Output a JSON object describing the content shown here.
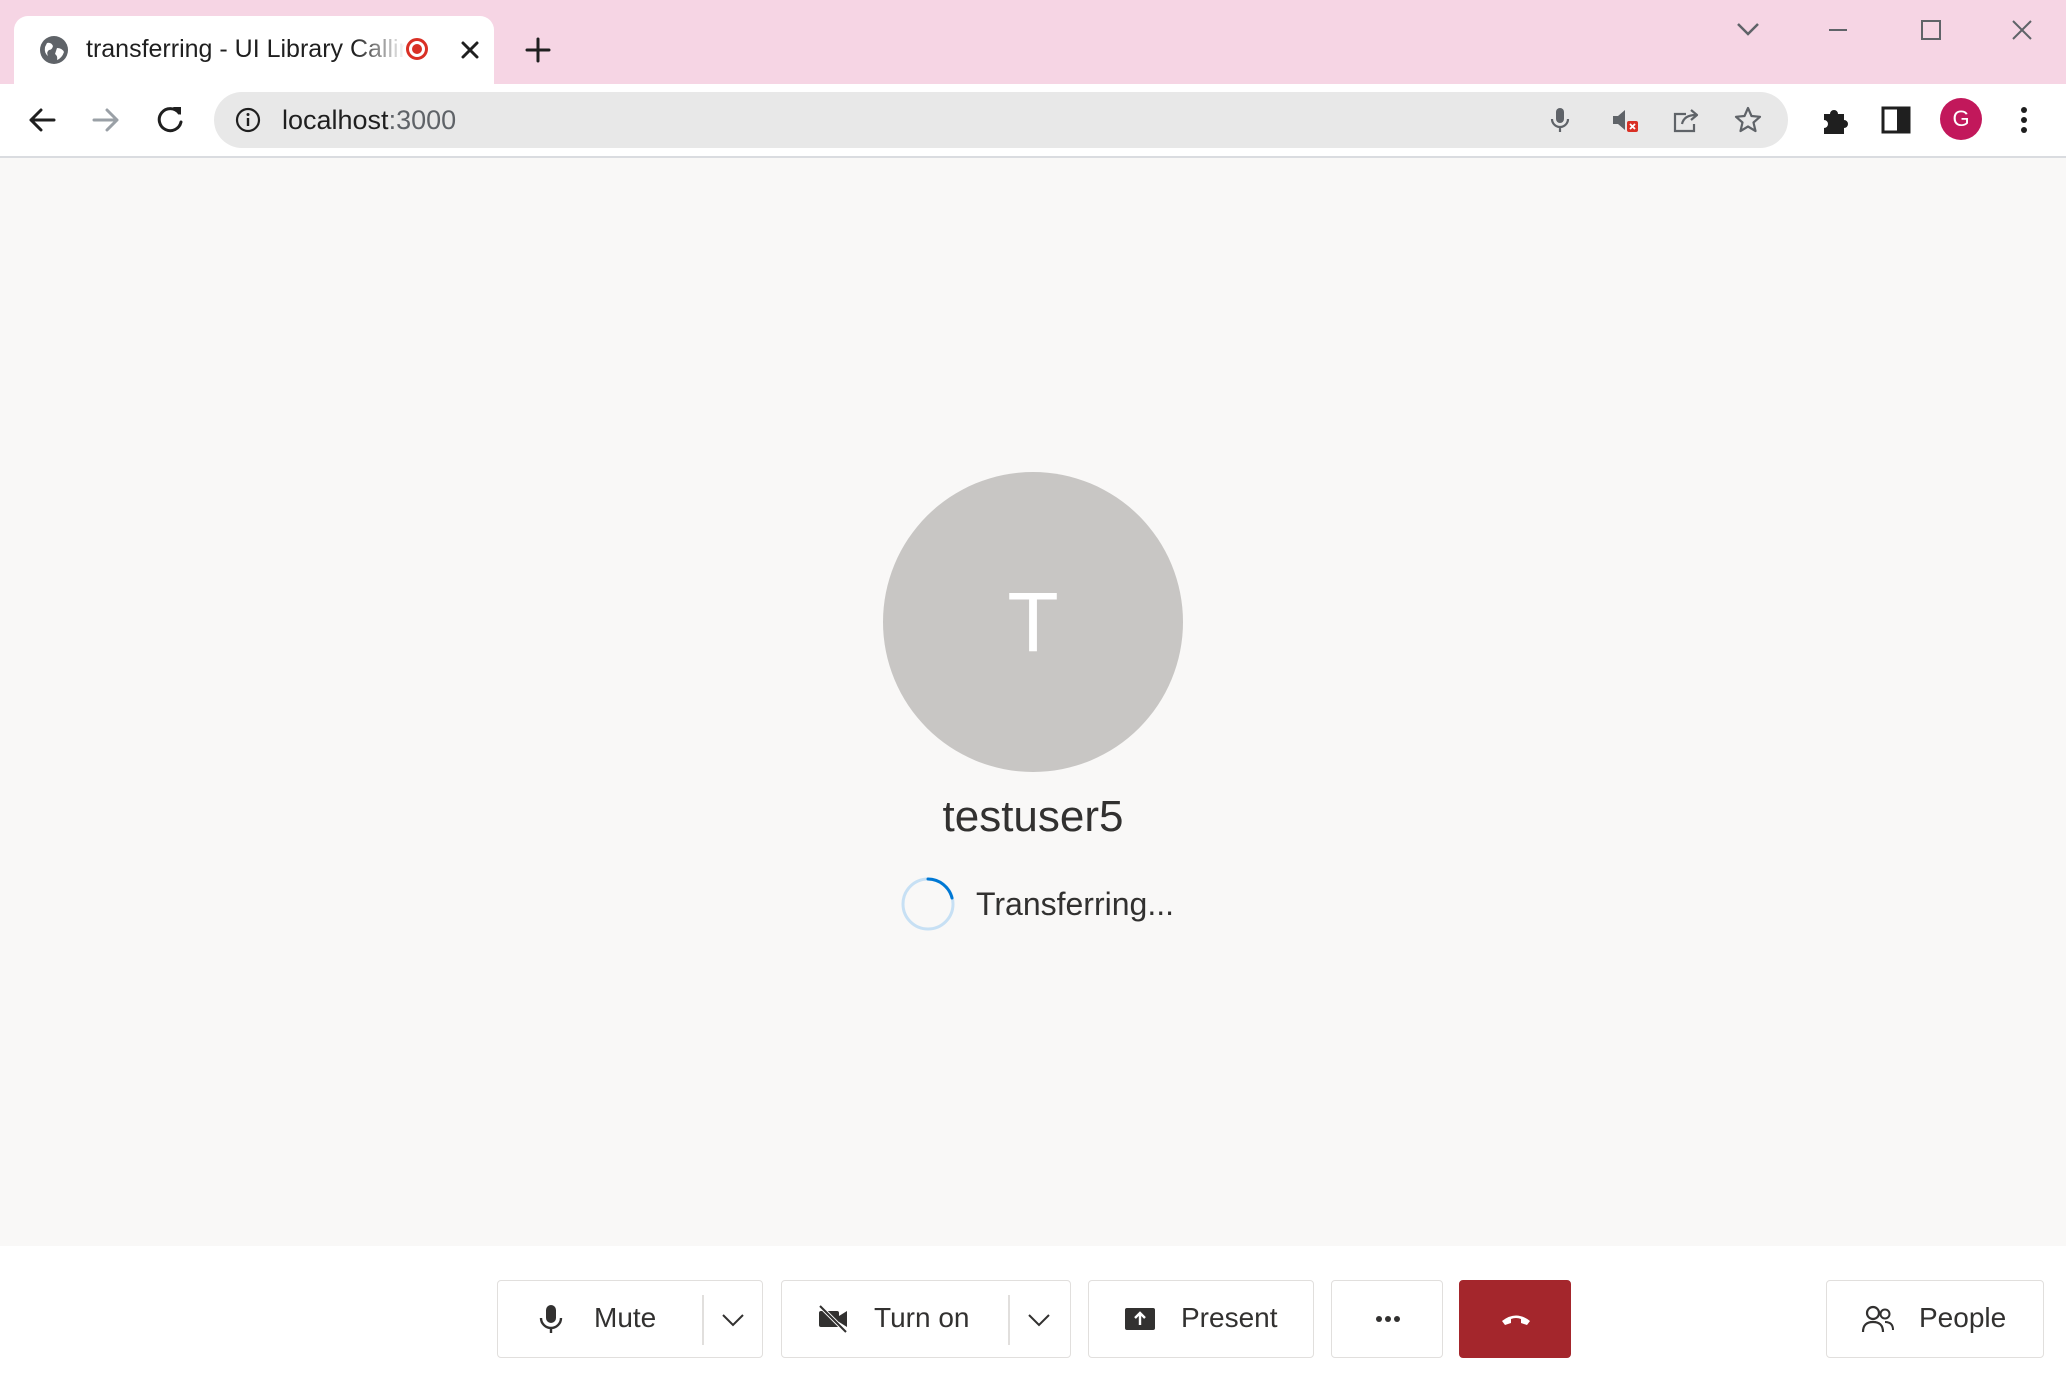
{
  "browser": {
    "tab": {
      "title": "transferring - UI Library Calling",
      "recording": true
    },
    "new_tab_label": "+",
    "address": {
      "host": "localhost",
      "port": ":3000"
    },
    "profile_initial": "G",
    "accent_color": "#f6d5e4"
  },
  "call": {
    "participant": {
      "initial": "T",
      "name": "testuser5"
    },
    "status_text": "Transferring...",
    "spinner_color": "#0078d4"
  },
  "controls": {
    "mute_label": "Mute",
    "camera_label": "Turn on",
    "present_label": "Present",
    "more_label": "...",
    "people_label": "People",
    "end_call_color": "#a4262c"
  }
}
